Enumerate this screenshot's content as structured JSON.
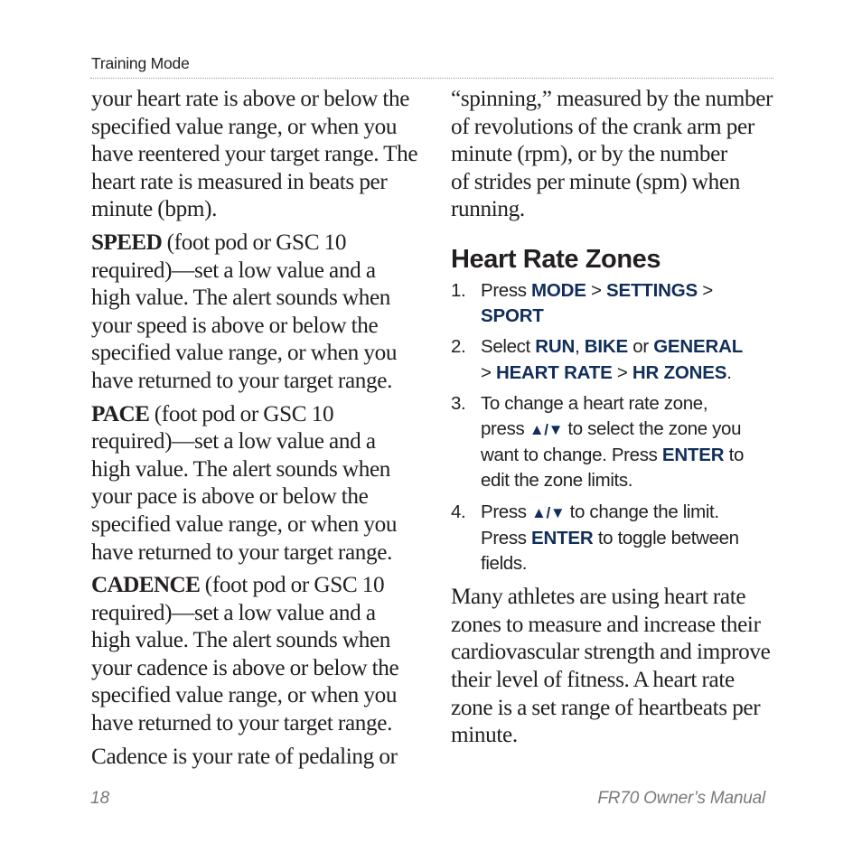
{
  "header": {
    "running_head": "Training Mode"
  },
  "left_column": {
    "intro_lines": [
      "your heart rate is above or below the",
      "specified value range, or when you",
      "have reentered your target range. The",
      "heart rate is measured in beats per",
      "minute (bpm)."
    ],
    "speed": {
      "term": "SPEED",
      "lines": [
        " (foot pod or GSC 10",
        "required)—set a low value and a",
        "high value. The alert sounds when",
        "your speed is above or below the",
        "specified value range, or when you",
        "have returned to your target range."
      ]
    },
    "pace": {
      "term": "PACE",
      "lines": [
        " (foot pod or GSC 10",
        "required)—set a low value and a",
        "high value. The alert sounds when",
        "your pace is above or below the",
        "specified value range, or when you",
        "have returned to your target range."
      ]
    },
    "cadence": {
      "term": "CADENCE",
      "lines": [
        " (foot pod or GSC 10",
        "required)—set a low value and a",
        "high value. The alert sounds when",
        "your cadence is above or below the",
        "specified value range, or when you",
        "have returned to your target range."
      ]
    },
    "cadence_def_line": "Cadence is your rate of pedaling or"
  },
  "right_column": {
    "cadence_def_lines": [
      "“spinning,” measured by the number",
      "of revolutions of the crank arm per",
      "minute (rpm), or by the number",
      "of strides per minute (spm) when",
      "running."
    ],
    "heading": "Heart Rate Zones",
    "steps": [
      {
        "num": "1.",
        "parts": {
          "t1": "Press ",
          "k1": "MODE",
          "t2": " > ",
          "k2": "SETTINGS",
          "t3": " >",
          "k3": "SPORT"
        }
      },
      {
        "num": "2.",
        "parts": {
          "t1": "Select ",
          "k1": "RUN",
          "t2": ", ",
          "k2": "BIKE",
          "t3": " or ",
          "k3": "GENERAL",
          "t4": "> ",
          "k4": "HEART RATE",
          "t5": " > ",
          "k5": "HR ZONES",
          "t6": "."
        }
      },
      {
        "num": "3.",
        "parts": {
          "l1": "To change a heart rate zone,",
          "t1": "press ",
          "arrows": "▲/▼",
          "t2": " to select the zone you",
          "t3": "want to change. Press ",
          "k1": "ENTER",
          "t4": " to",
          "l4": "edit the zone limits."
        }
      },
      {
        "num": "4.",
        "parts": {
          "t1": "Press ",
          "arrows": "▲/▼",
          "t2": " to change the limit.",
          "t3": "Press ",
          "k1": "ENTER",
          "t4": " to toggle between",
          "l3": "fields."
        }
      }
    ],
    "zones_paragraph_lines": [
      "Many athletes are using heart rate",
      "zones to measure and increase their",
      "cardiovascular strength and improve",
      "their level of fitness. A heart rate",
      "zone is a set range of heartbeats per",
      "minute."
    ]
  },
  "footer": {
    "page_number": "18",
    "manual_title": "FR70 Owner’s Manual"
  },
  "colors": {
    "keyword": "#112e5a",
    "body_text": "#231f20",
    "footer_text": "#7a7a7a"
  }
}
